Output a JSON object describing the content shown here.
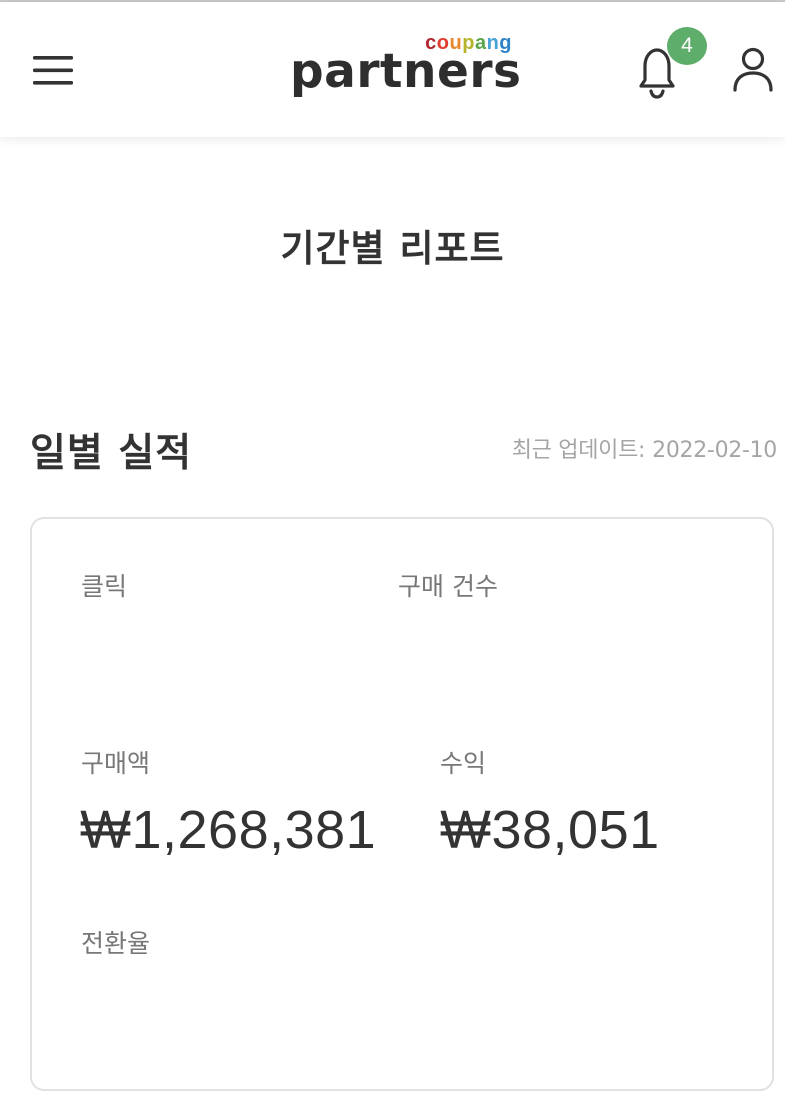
{
  "header": {
    "logo_top": "coupang",
    "logo_main": "partners",
    "logo_colors": [
      "#b0272d",
      "#e03c31",
      "#e8872b",
      "#b5b42b",
      "#5aa548",
      "#48a3d7",
      "#2f83c8"
    ],
    "notification_count": "4",
    "badge_color": "#5ead6a",
    "icons": {
      "menu": "hamburger-menu-icon",
      "bell": "bell-icon",
      "user": "user-icon"
    }
  },
  "page": {
    "title": "기간별 리포트"
  },
  "section": {
    "title": "일별 실적",
    "updated_label": "최근 업데이트:",
    "updated_date": "2022-02-10"
  },
  "metrics": {
    "clicks_label": "클릭",
    "orders_label": "구매 건수",
    "sales_label": "구매액",
    "sales_value": "₩1,268,381",
    "revenue_label": "수익",
    "revenue_value": "₩38,051",
    "conversion_label": "전환율"
  }
}
